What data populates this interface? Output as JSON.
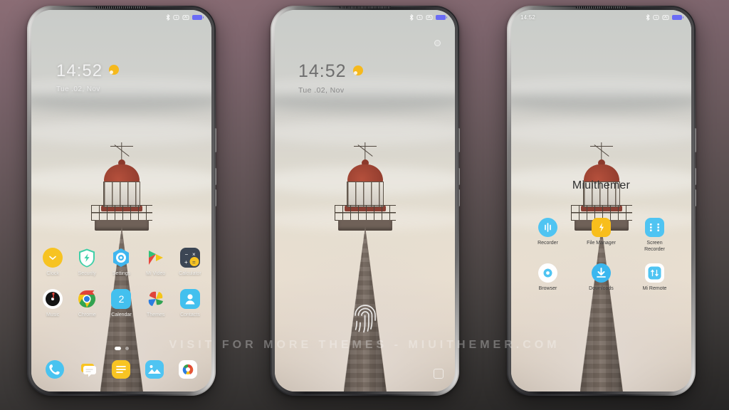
{
  "background": {
    "top_color": "#8b6d75",
    "bottom_color": "#262525"
  },
  "watermark": {
    "text": "VISIT FOR MORE THEMES - MIUITHEMER.COM"
  },
  "phones": [
    {
      "id": "phone-home-1",
      "kind": "home-screen",
      "status_bar": {
        "time": "",
        "icons": [
          "bluetooth-icon",
          "alarm-icon",
          "dnd-icon",
          "battery-icon"
        ]
      },
      "clock_widget": {
        "time": "14:52",
        "date": "Tue .02, Nov",
        "weather_icon": "sun-icon"
      },
      "rows": [
        [
          {
            "label": "Clock",
            "icon": "clock-icon"
          },
          {
            "label": "Security",
            "icon": "shield-icon"
          },
          {
            "label": "Settings",
            "icon": "settings-gear-icon"
          },
          {
            "label": "Mi Video",
            "icon": "play-triangle-icon"
          },
          {
            "label": "Calculator",
            "icon": "calculator-icon"
          }
        ],
        [
          {
            "label": "Music",
            "icon": "music-vinyl-icon"
          },
          {
            "label": "Chrome",
            "icon": "chrome-icon"
          },
          {
            "label": "Calendar",
            "icon": "calendar-icon",
            "day": "2"
          },
          {
            "label": "Themes",
            "icon": "pinwheel-icon"
          },
          {
            "label": "Contacts",
            "icon": "person-icon"
          }
        ]
      ],
      "dock": [
        {
          "label": "",
          "icon": "phone-icon"
        },
        {
          "label": "",
          "icon": "messages-icon"
        },
        {
          "label": "",
          "icon": "notes-icon"
        },
        {
          "label": "",
          "icon": "gallery-icon"
        },
        {
          "label": "",
          "icon": "camera-icon"
        }
      ],
      "page_indicator": {
        "pages": 2,
        "active": 0
      }
    },
    {
      "id": "phone-lock-2",
      "kind": "lock-screen",
      "status_bar": {
        "time": "",
        "icons": [
          "bluetooth-icon",
          "alarm-icon",
          "dnd-icon",
          "battery-icon"
        ]
      },
      "clock_widget": {
        "time": "14:52",
        "date": "Tue .02, Nov",
        "weather_icon": "sun-icon"
      },
      "unlock": {
        "icon": "fingerprint-icon"
      },
      "shortcut": {
        "icon": "camera-shortcut-icon"
      }
    },
    {
      "id": "phone-folder-3",
      "kind": "folder-open",
      "status_bar": {
        "time": "14:52",
        "icons": [
          "bluetooth-icon",
          "alarm-icon",
          "dnd-icon",
          "battery-icon"
        ]
      },
      "folder": {
        "title": "Miuithemer",
        "apps": [
          {
            "label": "Recorder",
            "icon": "recorder-icon"
          },
          {
            "label": "File Manager",
            "icon": "file-manager-icon"
          },
          {
            "label": "Screen Recorder",
            "icon": "screen-recorder-icon"
          },
          {
            "label": "Browser",
            "icon": "browser-icon"
          },
          {
            "label": "Downloads",
            "icon": "download-icon"
          },
          {
            "label": "Mi Remote",
            "icon": "remote-icon"
          }
        ]
      }
    }
  ]
}
